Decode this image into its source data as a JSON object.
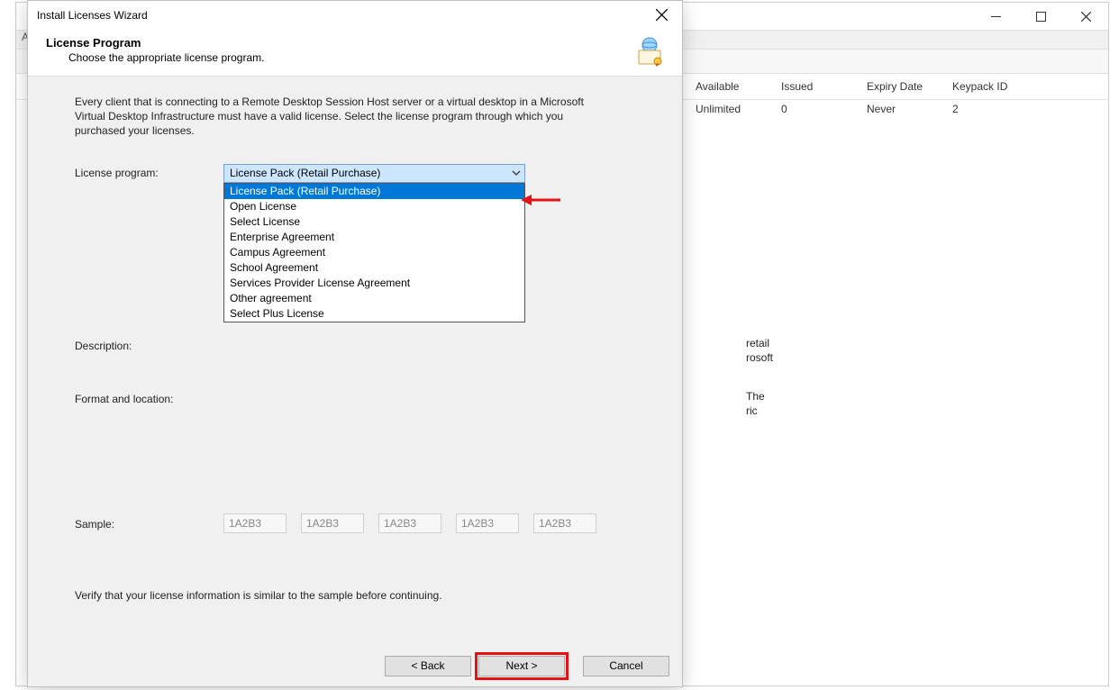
{
  "bg": {
    "truncatedMenuLeft": "Ac",
    "columns": [
      "Available",
      "Issued",
      "Expiry Date",
      "Keypack ID"
    ],
    "row": [
      "Unlimited",
      "0",
      "Never",
      "2"
    ]
  },
  "dialog": {
    "title": "Install Licenses Wizard",
    "header": {
      "title": "License Program",
      "subtitle": "Choose the appropriate license program."
    },
    "intro": "Every client that is connecting to a Remote Desktop Session Host server or a virtual desktop in a Microsoft Virtual Desktop Infrastructure must have a valid license. Select the license program through which you purchased your licenses.",
    "labels": {
      "licenseProgram": "License program:",
      "description": "Description:",
      "formatLocation": "Format and location:",
      "sample": "Sample:"
    },
    "combo": {
      "selected": "License Pack (Retail Purchase)",
      "options": [
        "License Pack (Retail Purchase)",
        "Open License",
        "Select License",
        "Enterprise Agreement",
        "Campus Agreement",
        "School Agreement",
        "Services Provider License Agreement",
        "Other agreement",
        "Select Plus License"
      ]
    },
    "descriptionFragments": {
      "a": "retail",
      "b": "rosoft"
    },
    "formatFragments": {
      "a": "The",
      "b": "ric"
    },
    "samplePlaceholder": "1A2B3",
    "verify": "Verify that your license information is similar to the sample before continuing.",
    "buttons": {
      "back": "< Back",
      "next": "Next >",
      "cancel": "Cancel"
    }
  }
}
